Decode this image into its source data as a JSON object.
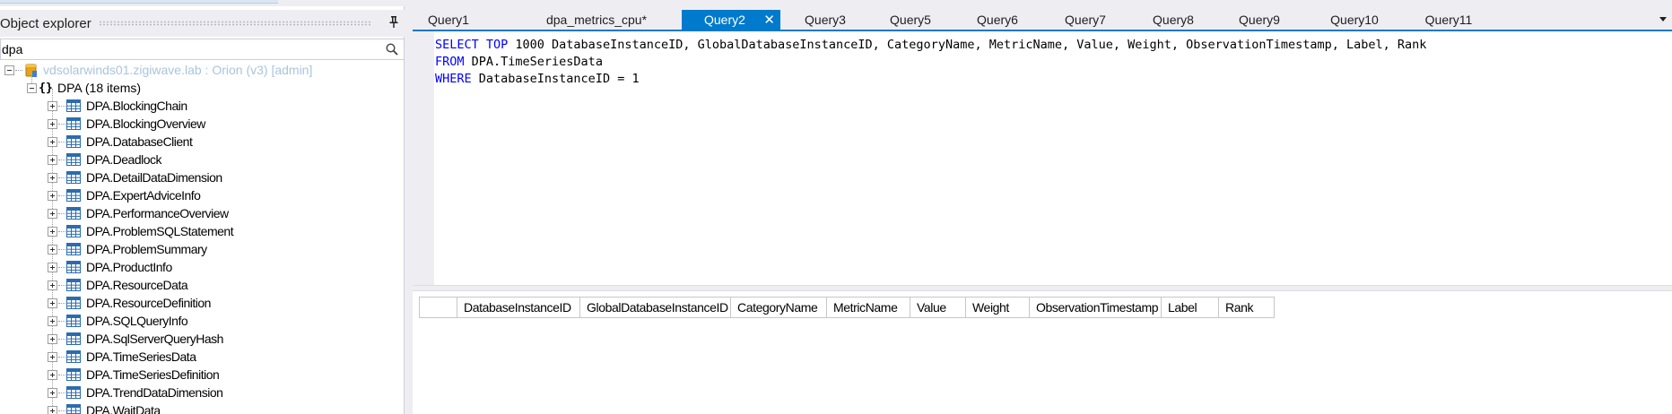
{
  "explorer": {
    "title": "Object explorer",
    "pin_icon": "pin-icon",
    "search": {
      "value": "dpa",
      "icon": "search-icon"
    },
    "server": {
      "label": "vdsolarwinds01.zigiwave.lab : Orion (v3) [admin]",
      "icon": "database-icon"
    },
    "namespace": {
      "label": "DPA (18 items)",
      "icon": "braces-icon"
    },
    "tables": [
      "DPA.BlockingChain",
      "DPA.BlockingOverview",
      "DPA.DatabaseClient",
      "DPA.Deadlock",
      "DPA.DetailDataDimension",
      "DPA.ExpertAdviceInfo",
      "DPA.PerformanceOverview",
      "DPA.ProblemSQLStatement",
      "DPA.ProblemSummary",
      "DPA.ProductInfo",
      "DPA.ResourceData",
      "DPA.ResourceDefinition",
      "DPA.SQLQueryInfo",
      "DPA.SqlServerQueryHash",
      "DPA.TimeSeriesData",
      "DPA.TimeSeriesDefinition",
      "DPA.TrendDataDimension",
      "DPA.WaitData"
    ]
  },
  "tabs": [
    {
      "label": "Query1",
      "active": false
    },
    {
      "label": "dpa_metrics_cpu*",
      "active": false
    },
    {
      "label": "Query2",
      "active": true
    },
    {
      "label": "Query3",
      "active": false
    },
    {
      "label": "Query5",
      "active": false
    },
    {
      "label": "Query6",
      "active": false
    },
    {
      "label": "Query7",
      "active": false
    },
    {
      "label": "Query8",
      "active": false
    },
    {
      "label": "Query9",
      "active": false
    },
    {
      "label": "Query10",
      "active": false
    },
    {
      "label": "Query11",
      "active": false
    }
  ],
  "tab_close_symbol": "✕",
  "editor": {
    "line1": {
      "kw": "SELECT TOP",
      "rest": " 1000 DatabaseInstanceID, GlobalDatabaseInstanceID, CategoryName, MetricName, Value, Weight, ObservationTimestamp, Label, Rank"
    },
    "line2": {
      "kw": "FROM",
      "rest": " DPA.TimeSeriesData"
    },
    "line3": {
      "kw": "WHERE",
      "rest": " DatabaseInstanceID = 1"
    }
  },
  "results": {
    "columns": [
      "",
      "DatabaseInstanceID",
      "GlobalDatabaseInstanceID",
      "CategoryName",
      "MetricName",
      "Value",
      "Weight",
      "ObservationTimestamp",
      "Label",
      "Rank"
    ]
  },
  "colors": {
    "accent": "#007acc",
    "keyword": "#0000ff",
    "server_text": "#a8c5dc",
    "chrome": "#eeeef2"
  }
}
